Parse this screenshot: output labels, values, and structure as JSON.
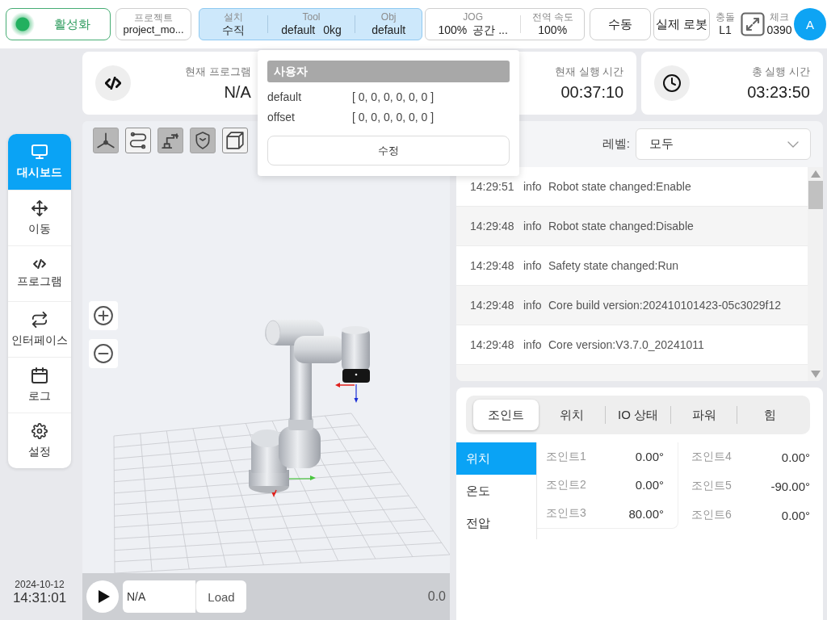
{
  "top_bar": {
    "enable_button": {
      "label": "활성화",
      "on": true
    },
    "project": {
      "label": "프로젝트",
      "value": "project_mo..."
    },
    "installation": {
      "active": true,
      "items": [
        {
          "label": "설치",
          "value": "수직"
        },
        {
          "label": "Tool",
          "value": "default",
          "payload": "0kg"
        },
        {
          "label": "Obj",
          "value": "default"
        }
      ]
    },
    "motion": [
      {
        "label": "JOG",
        "value": "100%",
        "mode": "공간 ..."
      },
      {
        "label": "전역 속도",
        "value": "100%"
      }
    ],
    "mode_button": "수동",
    "robot_button": "실제 로봇",
    "collision": {
      "label": "충돌",
      "value": "L1"
    },
    "check": {
      "label": "체크",
      "value": "0390"
    },
    "avatar": "A"
  },
  "popover": {
    "title": "사용자",
    "rows": [
      {
        "name": "default",
        "value": "[ 0, 0, 0, 0, 0, 0 ]"
      },
      {
        "name": "offset",
        "value": "[ 0, 0, 0, 0, 0, 0 ]"
      }
    ],
    "button": "수정"
  },
  "info_cards": [
    {
      "label": "현재 프로그램",
      "value": "N/A"
    },
    {
      "label": "현재 실행 시간",
      "value": "00:37:10"
    },
    {
      "label": "총 실행 시간",
      "value": "03:23:50"
    }
  ],
  "sidebar": [
    {
      "label": "대시보드",
      "selected": true
    },
    {
      "label": "이동",
      "selected": false
    },
    {
      "label": "프로그램",
      "selected": false
    },
    {
      "label": "인터페이스",
      "selected": false
    },
    {
      "label": "로그",
      "selected": false
    },
    {
      "label": "설정",
      "selected": false
    }
  ],
  "clock": {
    "date": "2024-10-12",
    "time": "14:31:01"
  },
  "viewer": {
    "tools": [
      {
        "on": true
      },
      {
        "on": false
      },
      {
        "on": true
      },
      {
        "on": true
      },
      {
        "on": false
      }
    ],
    "program": "N/A",
    "load_button": "Load",
    "reading": "0.0"
  },
  "log": {
    "level_label": "레벨:",
    "level_value": "모두",
    "entries": [
      {
        "time": "14:29:51",
        "level": "info",
        "message": "Robot state changed:Enable"
      },
      {
        "time": "14:29:48",
        "level": "info",
        "message": "Robot state changed:Disable"
      },
      {
        "time": "14:29:48",
        "level": "info",
        "message": "Safety state changed:Run"
      },
      {
        "time": "14:29:48",
        "level": "info",
        "message": "Core build version:202410101423-05c3029f12"
      },
      {
        "time": "14:29:48",
        "level": "info",
        "message": "Core version:V3.7.0_20241011"
      }
    ]
  },
  "joint_panel": {
    "tabs": [
      {
        "label": "조인트",
        "selected": true
      },
      {
        "label": "위치",
        "selected": false
      },
      {
        "label": "IO 상태",
        "selected": false
      },
      {
        "label": "파워",
        "selected": false
      },
      {
        "label": "힘",
        "selected": false
      }
    ],
    "categories": [
      {
        "label": "위치",
        "selected": true
      },
      {
        "label": "온도",
        "selected": false
      },
      {
        "label": "전압",
        "selected": false
      }
    ],
    "joints": [
      {
        "name": "조인트1",
        "value": "0.00°"
      },
      {
        "name": "조인트2",
        "value": "0.00°"
      },
      {
        "name": "조인트3",
        "value": "80.00°"
      },
      {
        "name": "조인트4",
        "value": "0.00°"
      },
      {
        "name": "조인트5",
        "value": "-90.00°"
      },
      {
        "name": "조인트6",
        "value": "0.00°"
      }
    ]
  }
}
